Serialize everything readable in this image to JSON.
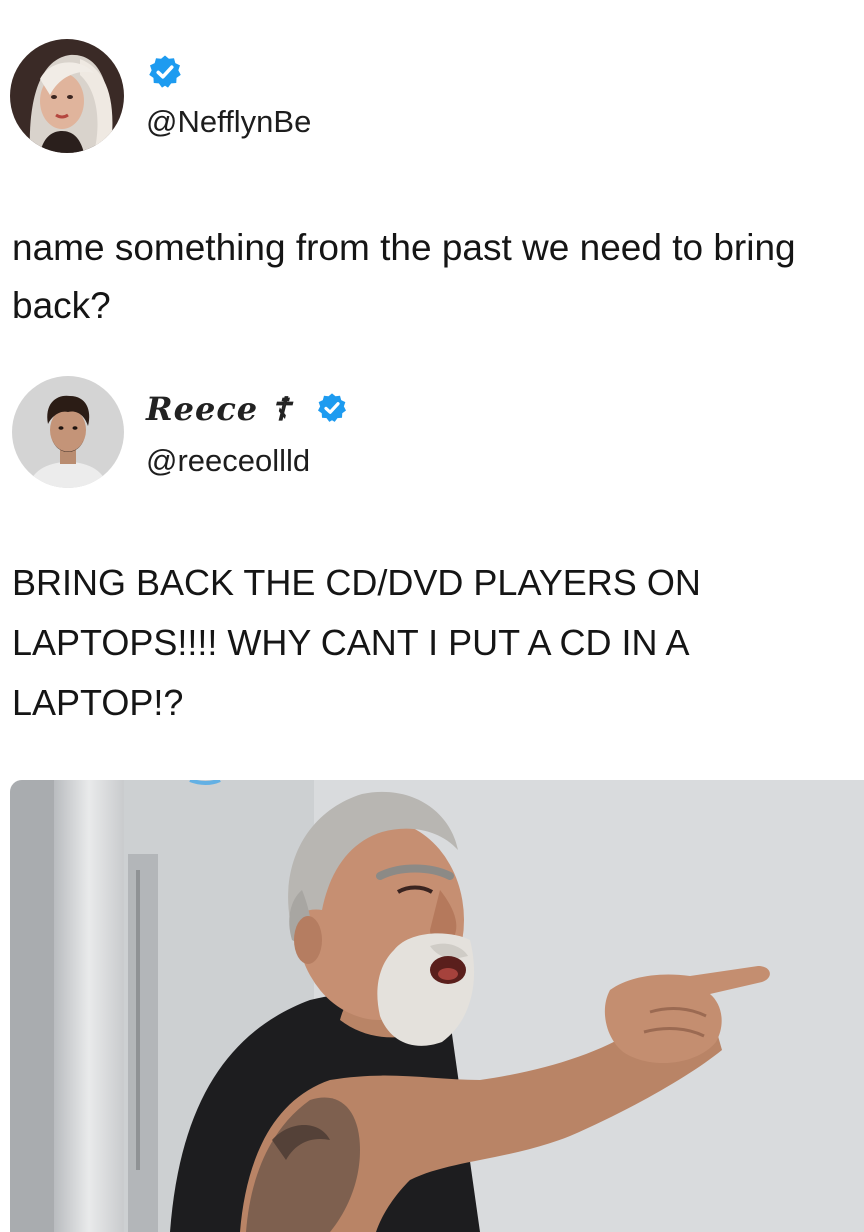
{
  "original_tweet": {
    "handle": "@NefflynBe",
    "verified": true,
    "avatar": "woman-portrait-avatar",
    "text": "name something from the past we need to bring back?"
  },
  "reply_tweet": {
    "display_name": "Reece ☦",
    "handle": "@reeceollld",
    "verified": true,
    "avatar": "man-portrait-avatar",
    "text": "BRING BACK THE CD/DVD PLAYERS ON LAPTOPS!!!! WHY CANT I PUT A CD IN A LAPTOP!?"
  },
  "meme_image": {
    "icon": "angry-man-pointing-photo"
  },
  "colors": {
    "verified_blue": "#1d9bf0",
    "background": "#ffffff",
    "text": "#151515"
  }
}
